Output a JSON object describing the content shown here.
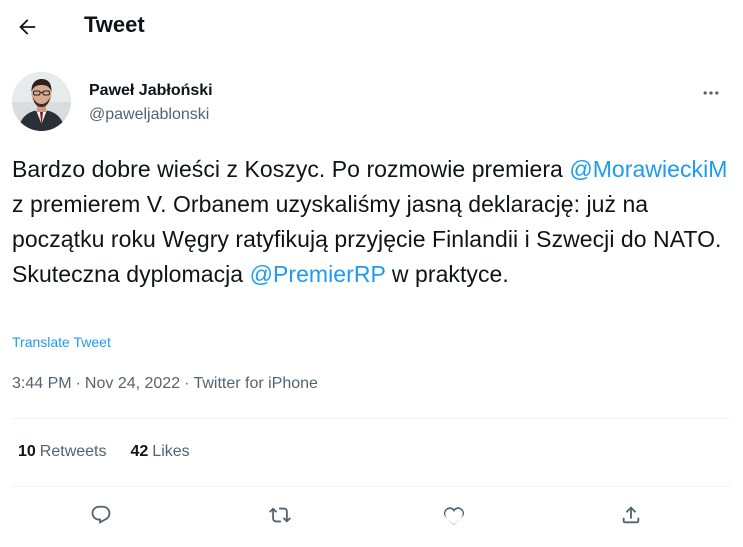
{
  "header": {
    "title": "Tweet",
    "back_icon": "arrow-left-icon"
  },
  "author": {
    "name": "Paweł Jabłoński",
    "handle": "@paweljablonski",
    "more_icon": "more-horizontal-icon"
  },
  "tweet": {
    "text_1": "Bardzo dobre wieści z Koszyc. Po rozmowie premiera ",
    "mention_1": "@MorawieckiM",
    "text_2": " z premierem V. Orbanem uzyskaliśmy jasną deklarację: już na początku roku Węgry ratyfikują przyjęcie Finlandii i Szwecji do NATO. Skuteczna dyplomacja ",
    "mention_2": "@PremierRP",
    "text_3": " w praktyce.",
    "translate_label": "Translate Tweet"
  },
  "meta": {
    "time": "3:44 PM",
    "separator": "·",
    "date": "Nov 24, 2022",
    "source": "Twitter for iPhone"
  },
  "stats": {
    "retweets_count": "10",
    "retweets_label": "Retweets",
    "likes_count": "42",
    "likes_label": "Likes"
  },
  "actions": [
    {
      "icon": "reply-icon"
    },
    {
      "icon": "retweet-icon"
    },
    {
      "icon": "like-icon"
    },
    {
      "icon": "share-icon"
    }
  ],
  "colors": {
    "accent": "#1d9bf0",
    "text": "#0f1419",
    "secondary": "#536471",
    "divider": "#eff3f4"
  }
}
